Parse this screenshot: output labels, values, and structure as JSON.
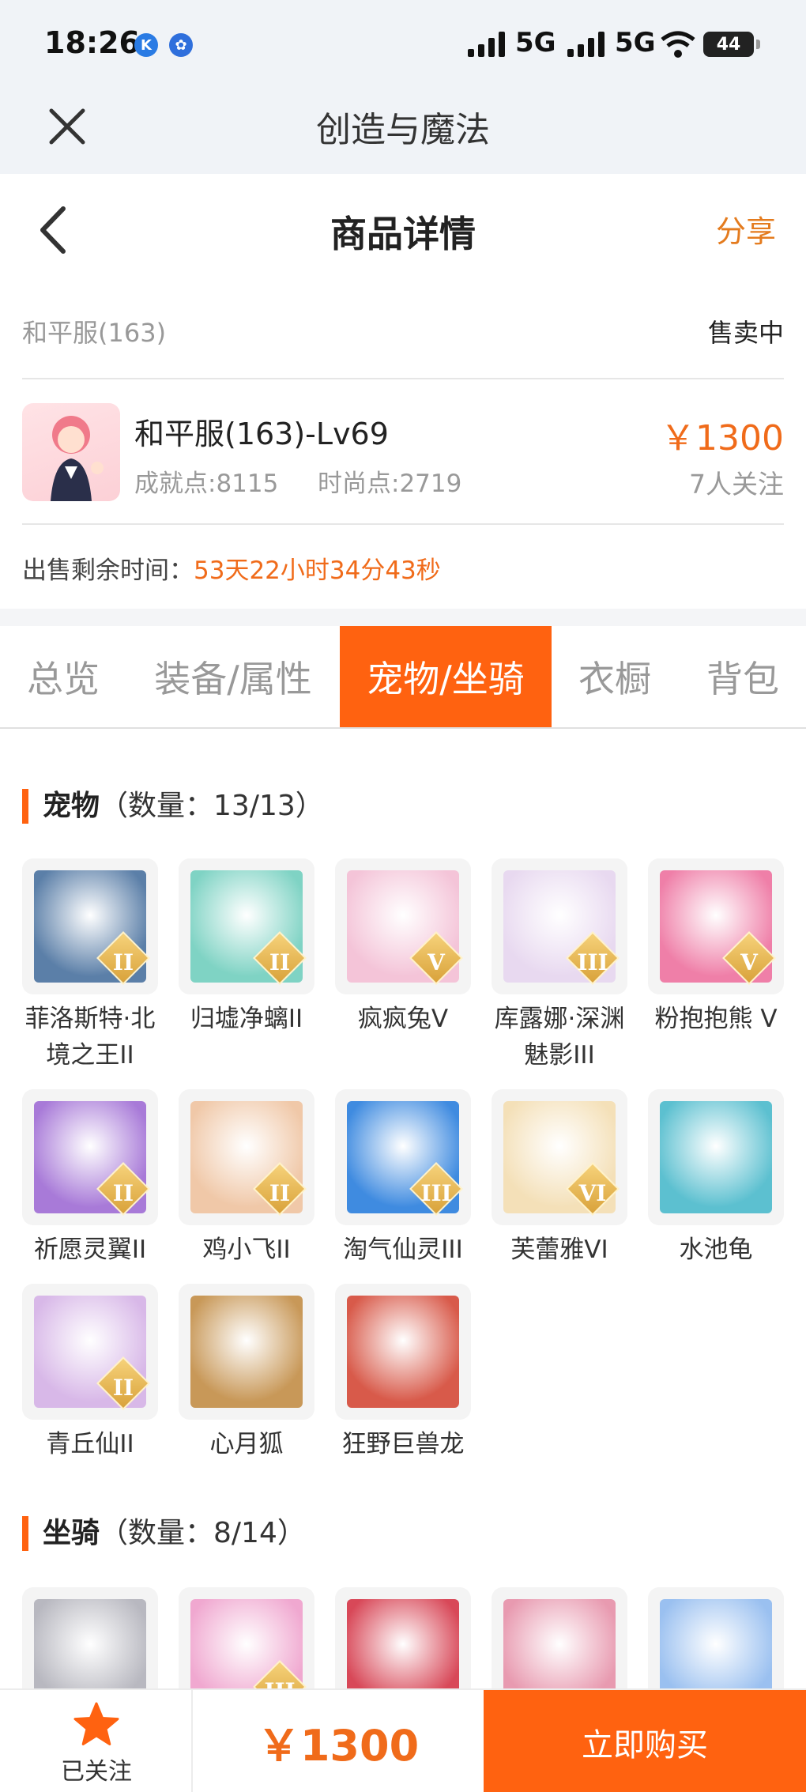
{
  "status_bar": {
    "time": "18:26",
    "network1": "5G",
    "network2": "5G",
    "battery": "44"
  },
  "app_header": {
    "title": "创造与魔法"
  },
  "page_header": {
    "title": "商品详情",
    "share": "分享"
  },
  "listing": {
    "server": "和平服(163)",
    "status": "售卖中",
    "character_name": "和平服(163)-Lv69",
    "achievement": "成就点:8115",
    "fashion": "时尚点:2719",
    "price": "￥1300",
    "followers": "7人关注",
    "remain_label": "出售剩余时间：",
    "remain_value": "53天22小时34分43秒"
  },
  "tabs": [
    {
      "label": "总览"
    },
    {
      "label": "装备/属性"
    },
    {
      "label": "宠物/坐骑",
      "active": true
    },
    {
      "label": "衣橱"
    },
    {
      "label": "背包"
    }
  ],
  "pets_section": {
    "title": "宠物",
    "count": "（数量：13/13）"
  },
  "pets": [
    {
      "name": "菲洛斯特·北境之王II",
      "badge": "II",
      "color": "#5b7fa8"
    },
    {
      "name": "归墟净螭II",
      "badge": "II",
      "color": "#7fd3c4"
    },
    {
      "name": "疯疯兔V",
      "badge": "V",
      "color": "#f4c4d8"
    },
    {
      "name": "库露娜·深渊魅影III",
      "badge": "III",
      "color": "#e8d9f0"
    },
    {
      "name": "粉抱抱熊 V",
      "badge": "V",
      "color": "#ef7fa8"
    },
    {
      "name": "祈愿灵翼II",
      "badge": "II",
      "color": "#a87ad8"
    },
    {
      "name": "鸡小飞II",
      "badge": "II",
      "color": "#f0c8a8"
    },
    {
      "name": "淘气仙灵III",
      "badge": "III",
      "color": "#3f8be0"
    },
    {
      "name": "芙蕾雅VI",
      "badge": "VI",
      "color": "#f4e0b8"
    },
    {
      "name": "水池龟",
      "badge": "",
      "color": "#5cc0d0"
    },
    {
      "name": "青丘仙II",
      "badge": "II",
      "color": "#d8b8e8"
    },
    {
      "name": "心月狐",
      "badge": "",
      "color": "#c89858"
    },
    {
      "name": "狂野巨兽龙",
      "badge": "",
      "color": "#d85a4a"
    }
  ],
  "mounts_section": {
    "title": "坐骑",
    "count": "（数量：8/14）"
  },
  "mounts": [
    {
      "name": "",
      "badge": "",
      "color": "#b8b8c0"
    },
    {
      "name": "",
      "badge": "III",
      "color": "#f0a8d0"
    },
    {
      "name": "",
      "badge": "",
      "color": "#d84858"
    },
    {
      "name": "",
      "badge": "",
      "color": "#e89ab0"
    },
    {
      "name": "",
      "badge": "",
      "color": "#9ac0f0"
    }
  ],
  "bottom_bar": {
    "follow_label": "已关注",
    "price": "￥1300",
    "buy_label": "立即购买"
  }
}
